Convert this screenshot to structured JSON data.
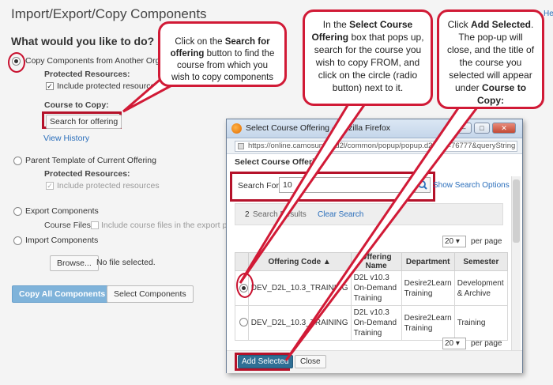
{
  "page": {
    "title": "Import/Export/Copy Components",
    "help_link": "He",
    "question": "What would you like to do?"
  },
  "options": {
    "copy_other": "Copy Components from Another Org Unit",
    "protected_resources": "Protected Resources:",
    "include_protected": "Include protected resources",
    "course_to_copy": "Course to Copy:",
    "search_button": "Search for offering",
    "view_history": "View History",
    "parent_template": "Parent Template of Current Offering",
    "export": "Export Components",
    "course_files": "Course Files:",
    "include_course_files": "Include course files in the export package",
    "import": "Import Components",
    "browse": "Browse...",
    "no_file": "No file selected.",
    "copy_all": "Copy All Components",
    "select_components": "Select Components"
  },
  "callouts": {
    "c1_pre": "Click on the",
    "c1_bold": "Search for offering",
    "c1_post": "button to find the course from which you wish to copy components",
    "c2_pre": "In the",
    "c2_bold": "Select Course Offering",
    "c2_post": "box that pops up, search for the course you wish to copy FROM, and click on the circle (radio button) next to it.",
    "c3_pre": "Click",
    "c3_bold": "Add Selected",
    "c3_mid": ". The pop-up will close, and the title of the course you selected will appear under",
    "c3_bold2": "Course to Copy:"
  },
  "popup": {
    "window_title": "Select Course Offering - Mozilla Firefox",
    "url": "https://online.camosun.ca/d2l/common/popup/popup.d2l?ou=76777&queryString",
    "heading": "Select Course Offering",
    "search_label": "Search For:",
    "search_value": "10",
    "search_options": "Show Search Options",
    "results_count": "2",
    "results_label": "Search Results",
    "clear_search": "Clear Search",
    "per_page_value": "20",
    "per_page_label": "per page",
    "columns": [
      "Offering Code ▲",
      "Offering Name",
      "Department",
      "Semester"
    ],
    "rows": [
      {
        "code": "DEV_D2L_10.3_TRAINING",
        "name_l1": "D2L v10.3",
        "name_l2": "On-Demand",
        "name_l3": "Training",
        "dept_l1": "Desire2Learn",
        "dept_l2": "Training",
        "sem_l1": "Development",
        "sem_l2": "& Archive"
      },
      {
        "code": "DEV_D2L_10.3_TRAINING",
        "name_l1": "D2L v10.3",
        "name_l2": "On-Demand",
        "name_l3": "Training",
        "dept_l1": "Desire2Learn",
        "dept_l2": "Training",
        "sem_l1": "Training",
        "sem_l2": ""
      }
    ],
    "add_selected": "Add Selected",
    "close": "Close"
  }
}
